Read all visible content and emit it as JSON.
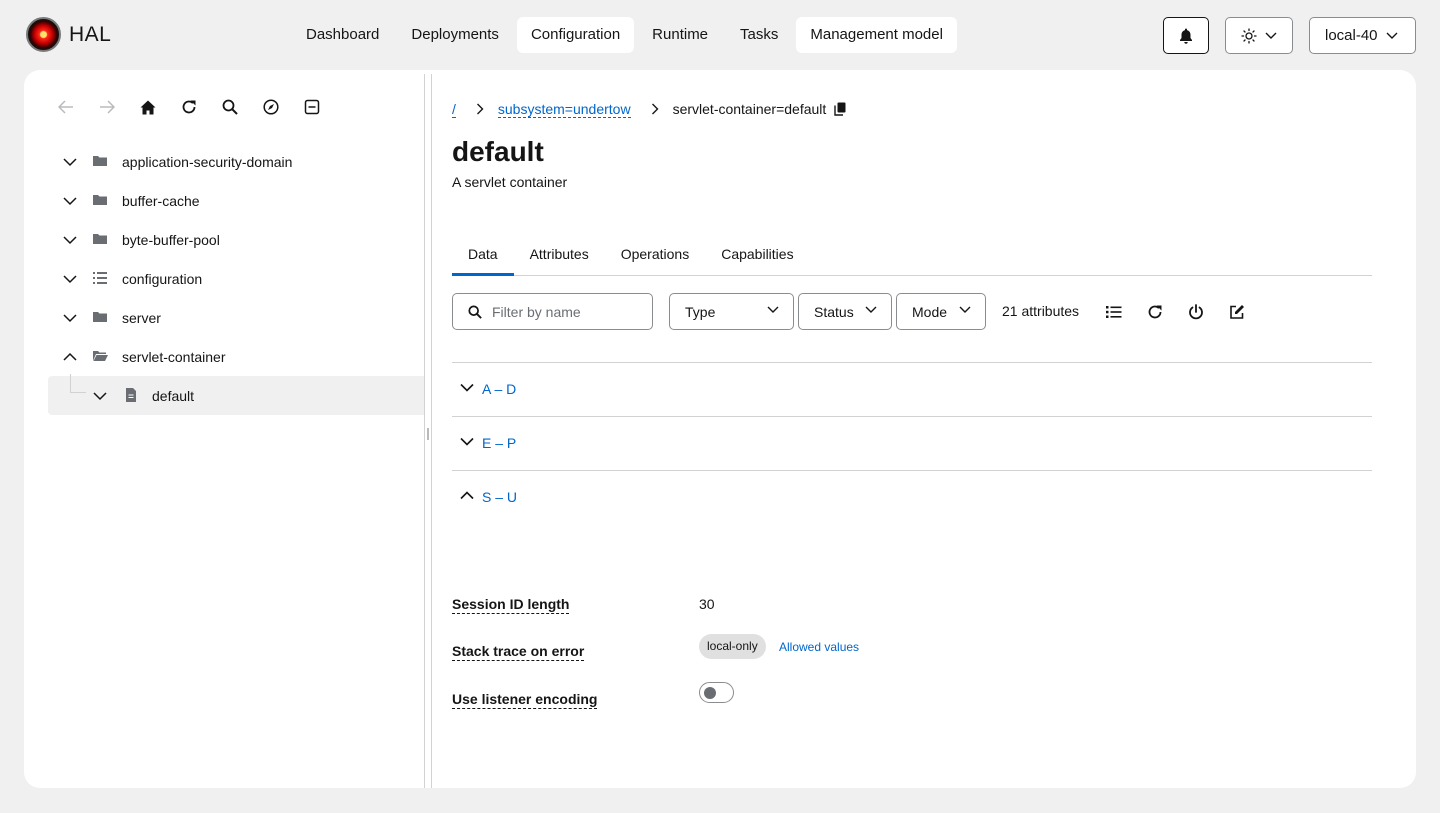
{
  "brand": {
    "name": "HAL"
  },
  "nav": {
    "items": [
      {
        "label": "Dashboard",
        "active": false
      },
      {
        "label": "Deployments",
        "active": false
      },
      {
        "label": "Configuration",
        "active": true
      },
      {
        "label": "Runtime",
        "active": false
      },
      {
        "label": "Tasks",
        "active": false
      },
      {
        "label": "Management model",
        "active": true
      }
    ]
  },
  "header": {
    "notifications_icon": "bell-icon",
    "theme_icon": "sun-icon",
    "server": "local-40"
  },
  "tree_toolbar": {
    "icons": [
      "back-icon",
      "forward-icon",
      "home-icon",
      "refresh-icon",
      "search-icon",
      "compass-icon",
      "collapse-all-icon"
    ]
  },
  "tree": {
    "items": [
      {
        "label": "application-security-domain",
        "icon": "folder-icon",
        "expanded": false
      },
      {
        "label": "buffer-cache",
        "icon": "folder-icon",
        "expanded": false
      },
      {
        "label": "byte-buffer-pool",
        "icon": "folder-icon",
        "expanded": false
      },
      {
        "label": "configuration",
        "icon": "list-icon",
        "expanded": false
      },
      {
        "label": "server",
        "icon": "folder-icon",
        "expanded": false
      },
      {
        "label": "servlet-container",
        "icon": "folder-open-icon",
        "expanded": true
      }
    ],
    "selected_child": {
      "label": "default",
      "icon": "file-icon"
    }
  },
  "breadcrumb": {
    "root": "/",
    "segment": "subsystem=undertow",
    "current": "servlet-container=default"
  },
  "page": {
    "title": "default",
    "description": "A servlet container"
  },
  "tabs": [
    {
      "label": "Data",
      "active": true
    },
    {
      "label": "Attributes",
      "active": false
    },
    {
      "label": "Operations",
      "active": false
    },
    {
      "label": "Capabilities",
      "active": false
    }
  ],
  "filter": {
    "search_placeholder": "Filter by name",
    "type_label": "Type",
    "status_label": "Status",
    "mode_label": "Mode",
    "count": "21 attributes"
  },
  "groups": [
    {
      "label": "A – D",
      "expanded": false
    },
    {
      "label": "E – P",
      "expanded": false
    },
    {
      "label": "S – U",
      "expanded": true
    }
  ],
  "attributes": {
    "session_id_length": {
      "name": "Session ID length",
      "value": "30"
    },
    "stack_trace_on_error": {
      "name": "Stack trace on error",
      "value": "local-only",
      "link": "Allowed values"
    },
    "use_listener_encoding": {
      "name": "Use listener encoding",
      "enabled": false
    }
  },
  "colors": {
    "accent": "#0066cc",
    "background": "#f0f0f0",
    "selected_row": "#f0f0f0"
  }
}
